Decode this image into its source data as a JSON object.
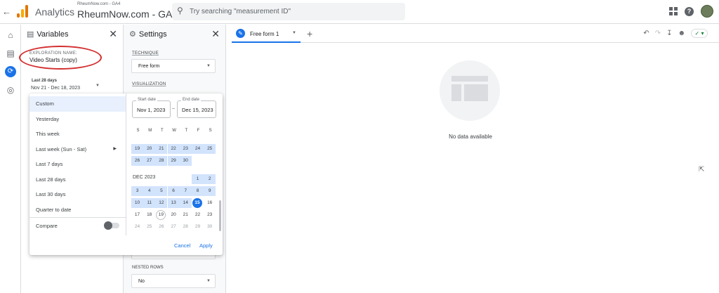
{
  "header": {
    "back_icon": "arrow-left-icon",
    "app_name": "Analytics",
    "account_small": "RheumNow.com - GA4",
    "account_big": "RheumNow.com - GA4",
    "search_placeholder": "Try searching \"measurement ID\""
  },
  "variables_panel": {
    "title": "Variables",
    "exploration_label": "EXPLORATION NAME:",
    "exploration_name": "Video Starts (copy)",
    "date_label": "Last 28 days",
    "date_range": "Nov 21 - Dec 18, 2023"
  },
  "settings_panel": {
    "title": "Settings",
    "technique_label": "TECHNIQUE",
    "technique_value": "Free form",
    "visualization_label": "VISUALIZATION",
    "nested_rows_label": "NESTED ROWS",
    "nested_rows_value": "No"
  },
  "tabs": {
    "tab_label": "Free form 1"
  },
  "canvas": {
    "empty_text": "No data available"
  },
  "date_picker": {
    "presets": [
      "Custom",
      "Yesterday",
      "This week",
      "Last week (Sun - Sat)",
      "Last 7 days",
      "Last 28 days",
      "Last 30 days",
      "Quarter to date"
    ],
    "compare_label": "Compare",
    "start_label": "Start date",
    "start_value": "Nov 1, 2023",
    "end_label": "End date",
    "end_value": "Dec 15, 2023",
    "separator": "–",
    "weekdays": [
      "S",
      "M",
      "T",
      "W",
      "T",
      "F",
      "S"
    ],
    "nov_rows": [
      [
        "19",
        "20",
        "21",
        "22",
        "23",
        "24",
        "25"
      ],
      [
        "26",
        "27",
        "28",
        "29",
        "30",
        "",
        ""
      ]
    ],
    "month_label": "DEC 2023",
    "dec_rows": [
      [
        "",
        "",
        "",
        "",
        "",
        "1",
        "2"
      ],
      [
        "3",
        "4",
        "5",
        "6",
        "7",
        "8",
        "9"
      ],
      [
        "10",
        "11",
        "12",
        "13",
        "14",
        "15",
        "16"
      ],
      [
        "17",
        "18",
        "19",
        "20",
        "21",
        "22",
        "23"
      ],
      [
        "24",
        "25",
        "26",
        "27",
        "28",
        "29",
        "30"
      ]
    ],
    "cancel_label": "Cancel",
    "apply_label": "Apply"
  },
  "colors": {
    "accent": "#1a73e8",
    "range_fill": "#d2e3fc",
    "selected_preset": "#e8f0fe",
    "annotation": "#d32f2f"
  }
}
